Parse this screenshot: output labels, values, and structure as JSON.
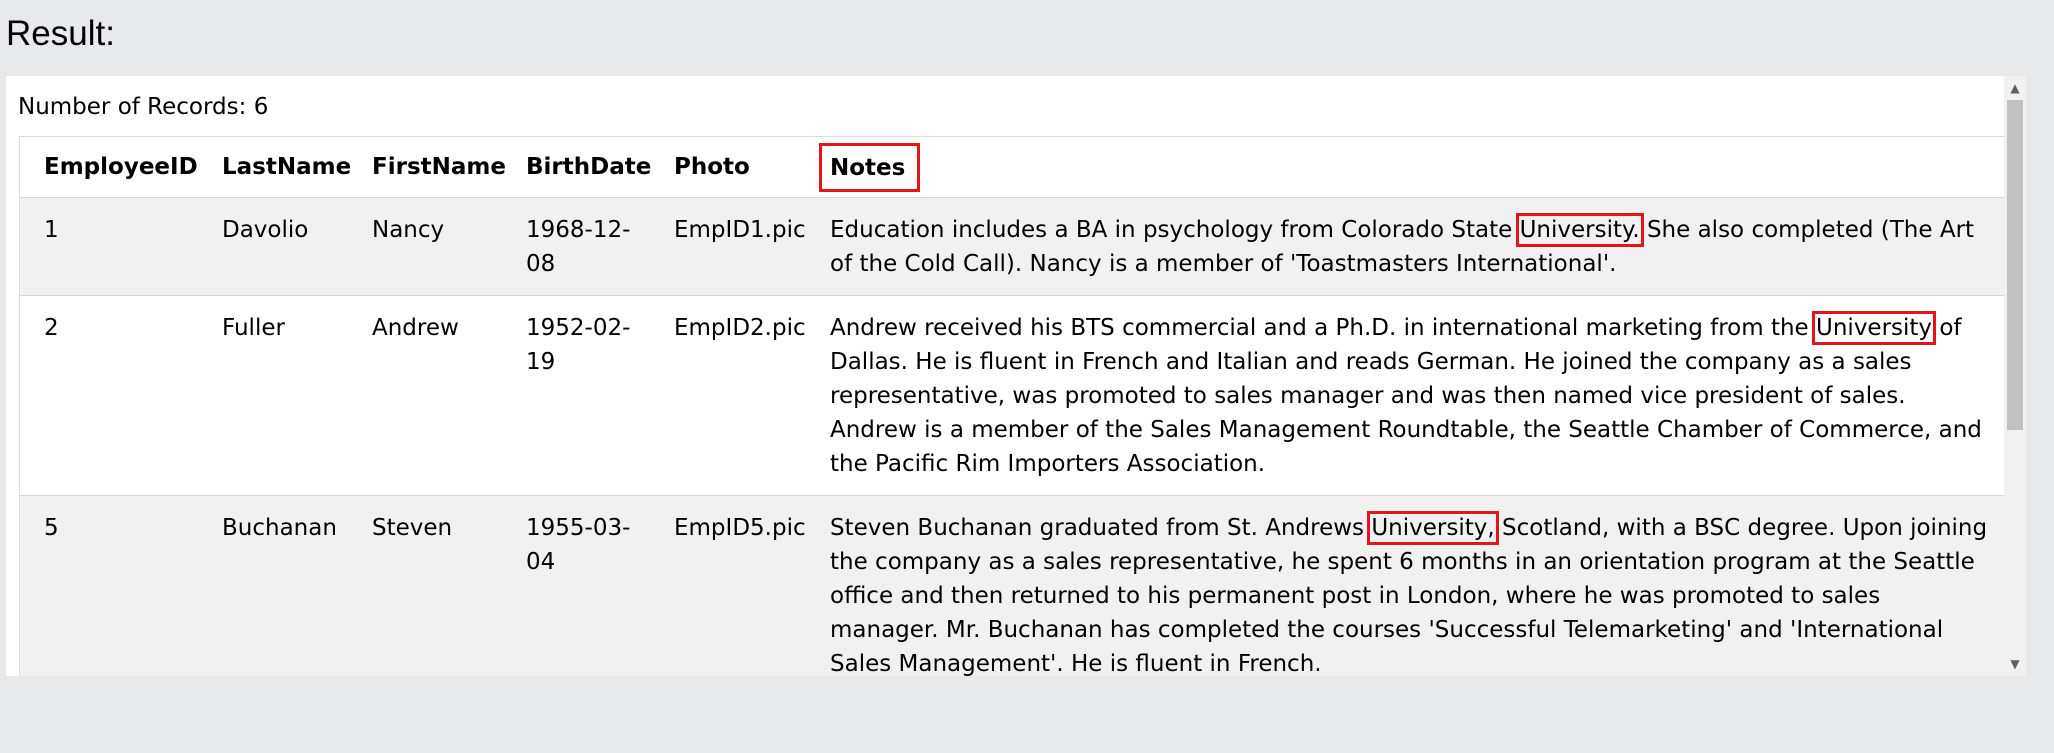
{
  "page": {
    "title": "Result:",
    "records_label": "Number of Records: 6"
  },
  "table": {
    "columns": [
      "EmployeeID",
      "LastName",
      "FirstName",
      "BirthDate",
      "Photo",
      "Notes"
    ],
    "rows": [
      {
        "id": "1",
        "last": "Davolio",
        "first": "Nancy",
        "birth": "1968-12-08",
        "photo": "EmpID1.pic",
        "notes_before": "Education includes a BA in psychology from Colorado State ",
        "notes_highlight": "University.",
        "notes_after": " She also completed (The Art of the Cold Call). Nancy is a member of 'Toastmasters International'."
      },
      {
        "id": "2",
        "last": "Fuller",
        "first": "Andrew",
        "birth": "1952-02-19",
        "photo": "EmpID2.pic",
        "notes_before": "Andrew received his BTS commercial and a Ph.D. in international marketing from the ",
        "notes_highlight": "University",
        "notes_after": " of Dallas. He is fluent in French and Italian and reads German. He joined the company as a sales representative, was promoted to sales manager and was then named vice president of sales. Andrew is a member of the Sales Management Roundtable, the Seattle Chamber of Commerce, and the Pacific Rim Importers Association."
      },
      {
        "id": "5",
        "last": "Buchanan",
        "first": "Steven",
        "birth": "1955-03-04",
        "photo": "EmpID5.pic",
        "notes_before": "Steven Buchanan graduated from St. Andrews ",
        "notes_highlight": "University,",
        "notes_after": " Scotland, with a BSC degree. Upon joining the company as a sales representative, he spent 6 months in an orientation program at the Seattle office and then returned to his permanent post in London, where he was promoted to sales manager. Mr. Buchanan has completed the courses 'Successful Telemarketing' and 'International Sales Management'. He is fluent in French."
      }
    ]
  },
  "colors": {
    "highlight": "#e3141c",
    "page_bg": "#e8e9eb",
    "row_alt": "#f1f1f1"
  },
  "icons": {
    "scroll_up": "scroll-up-arrow-icon",
    "scroll_down": "scroll-down-arrow-icon"
  }
}
